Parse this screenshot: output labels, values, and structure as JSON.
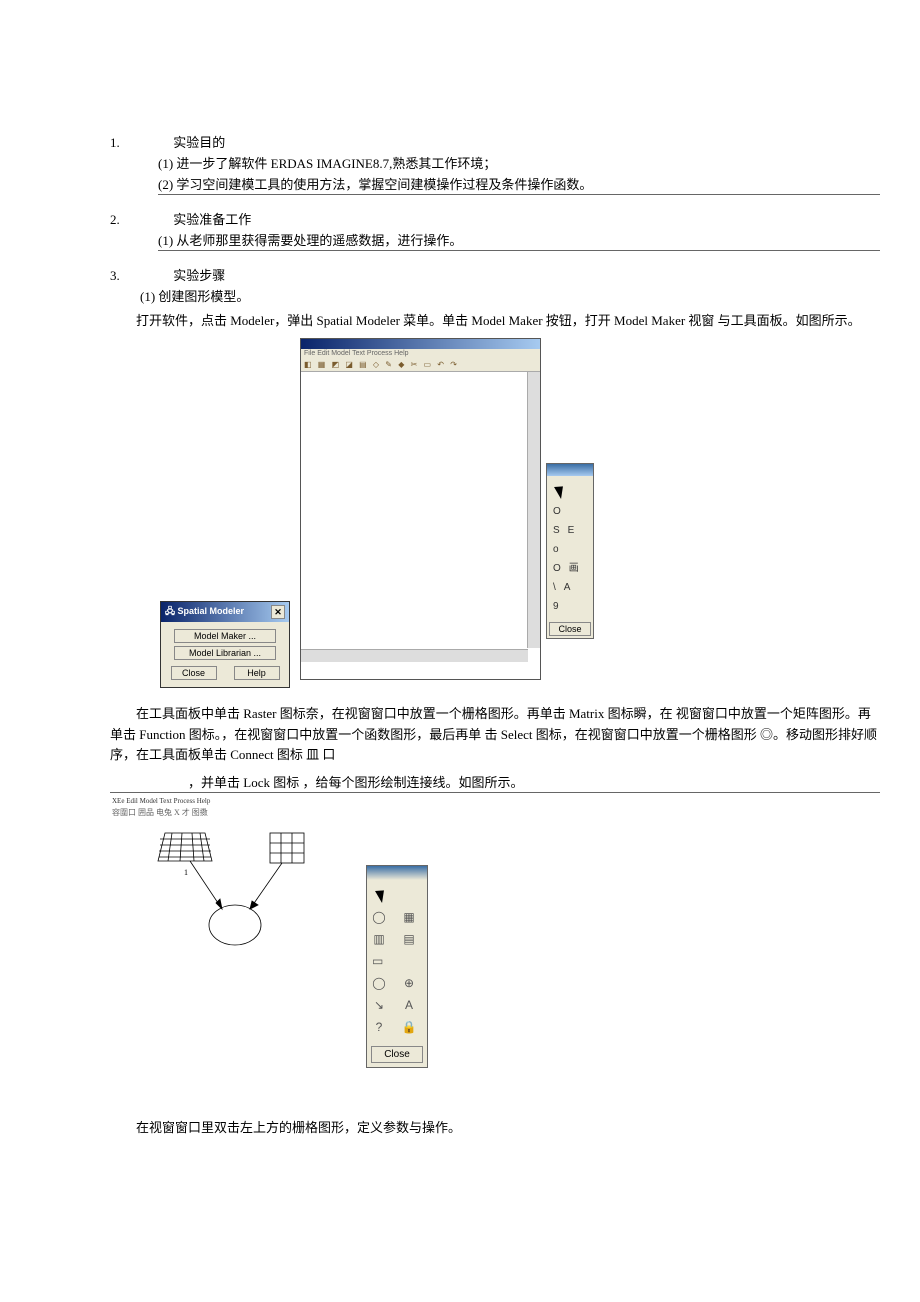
{
  "section1": {
    "num": "1.",
    "title": "实验目的",
    "item1_lbl": "(1)",
    "item1_txt": "进一步了解软件 ERDAS IMAGINE8.7,熟悉其工作环境；",
    "item2_lbl": "(2)",
    "item2_txt": "学习空间建模工具的使用方法，掌握空间建模操作过程及条件操作函数。"
  },
  "section2": {
    "num": "2.",
    "title": "实验准备工作",
    "item1_lbl": "(1)",
    "item1_txt": "从老师那里获得需要处理的遥感数据，进行操作。"
  },
  "section3": {
    "num": "3.",
    "title": "实验步骤",
    "item1_lbl": "(1)",
    "item1_txt": "创建图形模型。",
    "para1": "打开软件，点击 Modeler，弹出 Spatial Modeler 菜单。单击 Model Maker 按钮，打开 Model Maker 视窗 与工具面板。如图所示。"
  },
  "spatialModeler": {
    "title": "Spatial Modeler",
    "btn_maker": "Model Maker ...",
    "btn_lib": "Model Librarian ...",
    "btn_close": "Close",
    "btn_help": "Help"
  },
  "canvasWin": {
    "menu": "File Edit Model Text Process Help",
    "toolbar_glyphs": "◧ ▦ ◩ ◪ ▤ ◇ ✎ ◆ ✂ ▭ ↶ ↷"
  },
  "toolPalette1": {
    "rows": [
      [
        "O",
        ""
      ],
      [
        "S",
        "E"
      ],
      [
        "o",
        ""
      ],
      [
        "O",
        "画"
      ],
      [
        "\\",
        "A"
      ],
      [
        "9",
        ""
      ]
    ],
    "close": "Close"
  },
  "para2": "在工具面板中单击 Raster 图标奈，在视窗窗口中放置一个栅格图形。再单击 Matrix 图标瞬，在 视窗窗口中放置一个矩阵图形。再单击 Function 图标。，在视窗窗口中放置一个函数图形，最后再单 击 Select 图标，在视窗窗口中放置一个栅格图形 ◎。移动图形排好顺序，在工具面板单击 Connect 图标   皿        口",
  "para2b": "，并单击 Lock 图标     ，给每个图形绘制连接线。如图所示。",
  "shot2": {
    "menu": "XEe Edil Model Text Process Help",
    "toolbar": "容圍口 囲品          电兔 X  才 图擞"
  },
  "toolPalette2": {
    "close": "Close"
  },
  "para3": "在视窗窗口里双击左上方的栅格图形，定义参数与操作。"
}
